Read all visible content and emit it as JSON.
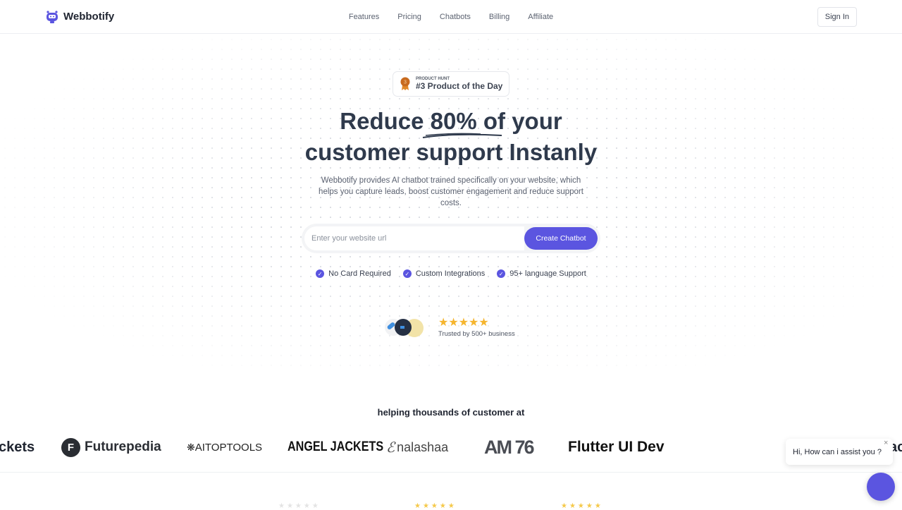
{
  "header": {
    "brand": "Webbotify",
    "nav": [
      "Features",
      "Pricing",
      "Chatbots",
      "Billing",
      "Affiliate"
    ],
    "sign_in": "Sign In"
  },
  "badge": {
    "small": "PRODUCT HUNT",
    "big": "#3 Product of the Day",
    "rank": "3"
  },
  "hero": {
    "line1a": "Reduce ",
    "line1b": "80%",
    "line1c": " of your",
    "line2": "customer support Instanly",
    "subtitle": "Webbotify provides AI chatbot trained specifically on your website, which helps you capture leads, boost customer engagement and reduce support costs."
  },
  "cta": {
    "placeholder": "Enter your website url",
    "button": "Create Chatbot"
  },
  "features": [
    "No Card Required",
    "Custom Integrations",
    "95+ language Support"
  ],
  "trust": {
    "stars": "★★★★★",
    "rating": 5,
    "text": "Trusted by 500+ business"
  },
  "customers": {
    "heading": "helping thousands of customer at",
    "logos": [
      "ckets",
      "Futurepedia",
      "AITOPTOOLS",
      "ANGEL JACKETS",
      "nalashaa",
      "AM 76",
      "Flutter UI Dev",
      "ac"
    ]
  },
  "chat": {
    "greeting": "Hi, How can i assist you ?",
    "close": "×"
  },
  "colors": {
    "accent": "#5b55e0",
    "heading": "#2f3a4c",
    "star": "#f5b52e"
  }
}
